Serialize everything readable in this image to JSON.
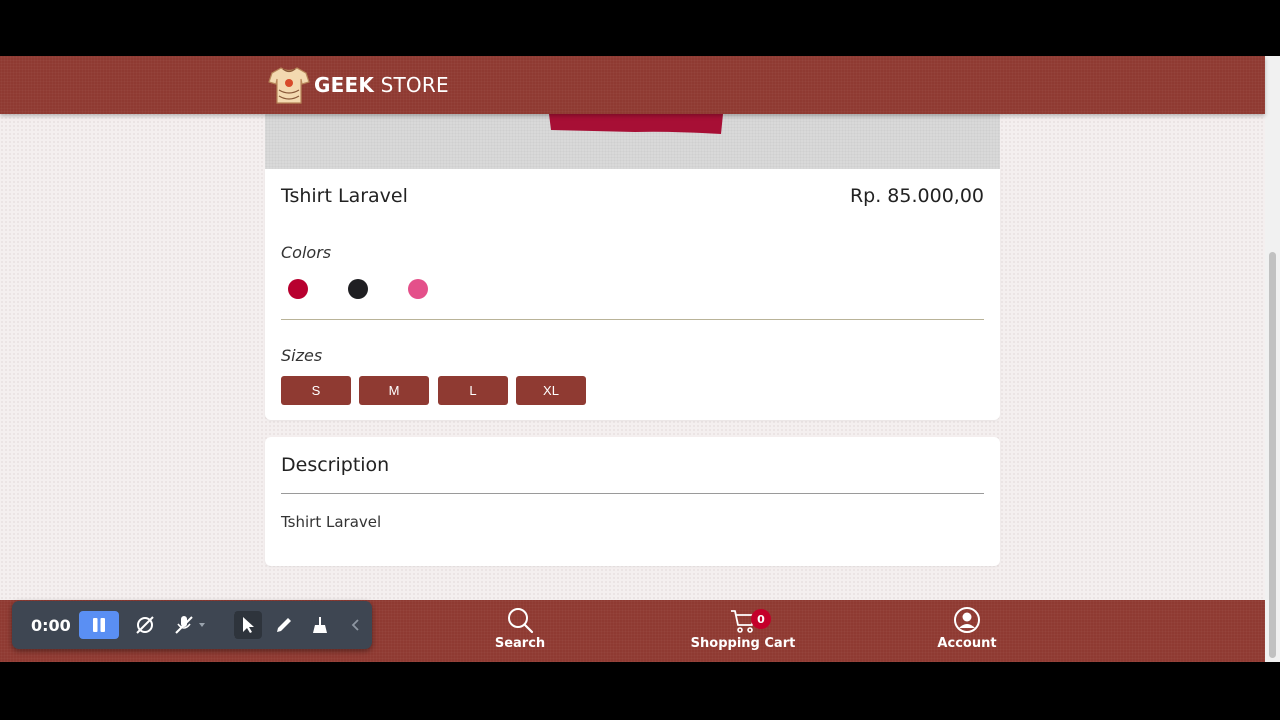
{
  "header": {
    "brand_bold": "GEEK",
    "brand_light": "STORE"
  },
  "product": {
    "name": "Tshirt Laravel",
    "price": "Rp. 85.000,00",
    "colors_label": "Colors",
    "colors": [
      "#b8002f",
      "#1f1f22",
      "#e4508a"
    ],
    "sizes_label": "Sizes",
    "sizes": [
      "S",
      "M",
      "L",
      "XL"
    ]
  },
  "description": {
    "title": "Description",
    "text": "Tshirt Laravel"
  },
  "bottom_nav": {
    "search_label": "Search",
    "cart_label": "Shopping Cart",
    "cart_count": "0",
    "account_label": "Account"
  },
  "recorder": {
    "time": "0:00"
  },
  "colors": {
    "brand": "#8f3a32",
    "badge": "#c4002a",
    "recorder_accent": "#5a8ff3"
  }
}
